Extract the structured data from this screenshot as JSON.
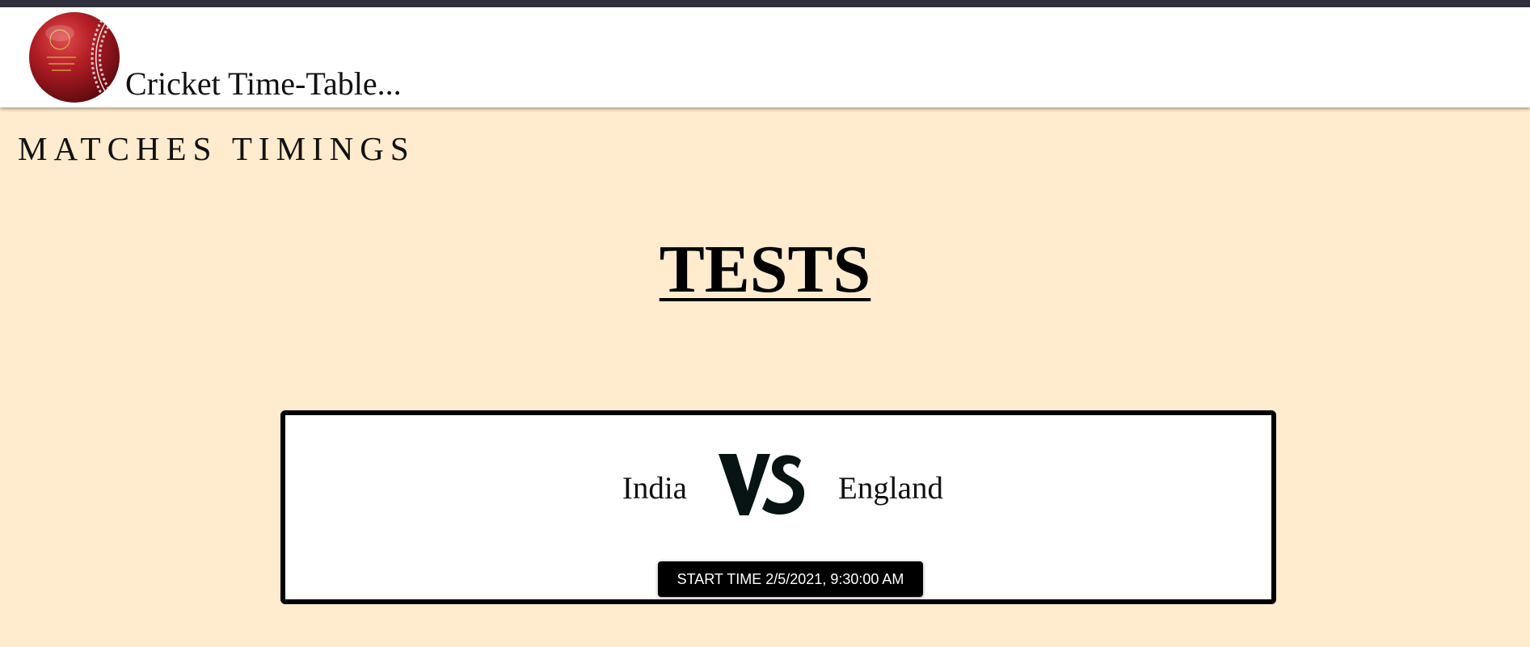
{
  "header": {
    "title": "Cricket Time-Table...",
    "logo_icon": "cricket-ball-icon"
  },
  "main": {
    "section_heading": "MATCHES TIMINGS",
    "category": "TESTS",
    "matches": [
      {
        "team_home": "India",
        "team_away": "England",
        "versus_icon": "vs-icon",
        "start_time_label": "START TIME 2/5/2021, 9:30:00 AM"
      }
    ]
  },
  "colors": {
    "page_background": "#ffebcd",
    "top_strip": "#2f2f3d",
    "navbar_background": "#ffffff",
    "ball_red": "#a3151f",
    "card_border": "#000000",
    "button_background": "#000000",
    "button_text": "#ffffff"
  }
}
